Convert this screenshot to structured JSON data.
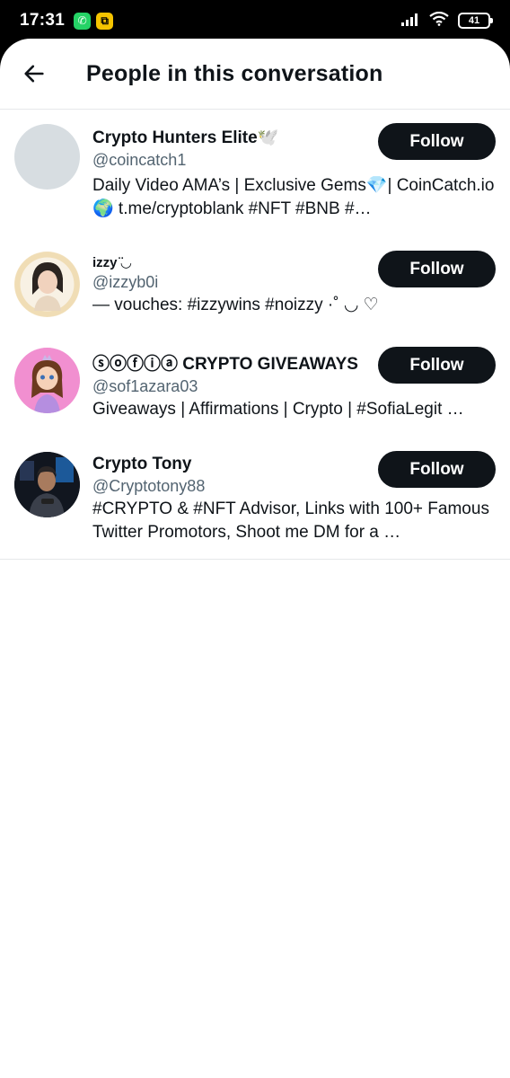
{
  "status_bar": {
    "time": "17:31",
    "notification_icons": [
      "whatsapp-icon",
      "app-notification-icon"
    ],
    "battery": "41"
  },
  "header": {
    "title": "People in this conversation"
  },
  "follow_label": "Follow",
  "users": [
    {
      "name": "Crypto Hunters Elite🕊️",
      "handle": "@coincatch1",
      "bio": "Daily Video AMA’s | Exclusive Gems💎| CoinCatch.io🌍 t.me/cryptoblank #NFT #BNB #…",
      "avatar": "blank-avatar"
    },
    {
      "name": "izzy ̈◡",
      "handle": "@izzyb0i",
      "bio": "— vouches: #izzywins #noizzy ·˚ ◡ ♡",
      "avatar": "photo-avatar-woman"
    },
    {
      "name": "ⓢⓞⓕⓘⓐ CRYPTO GIVEAWAYS",
      "handle": "@sof1azara03",
      "bio": "Giveaways | Affirmations | Crypto | #SofiaLegit …",
      "avatar": "cartoon-princess-avatar"
    },
    {
      "name": "Crypto Tony",
      "handle": "@Cryptotony88",
      "bio": "#CRYPTO & #NFT Advisor, Links with 100+ Famous Twitter Promotors, Shoot me DM  for a …",
      "avatar": "photo-avatar-man"
    }
  ]
}
